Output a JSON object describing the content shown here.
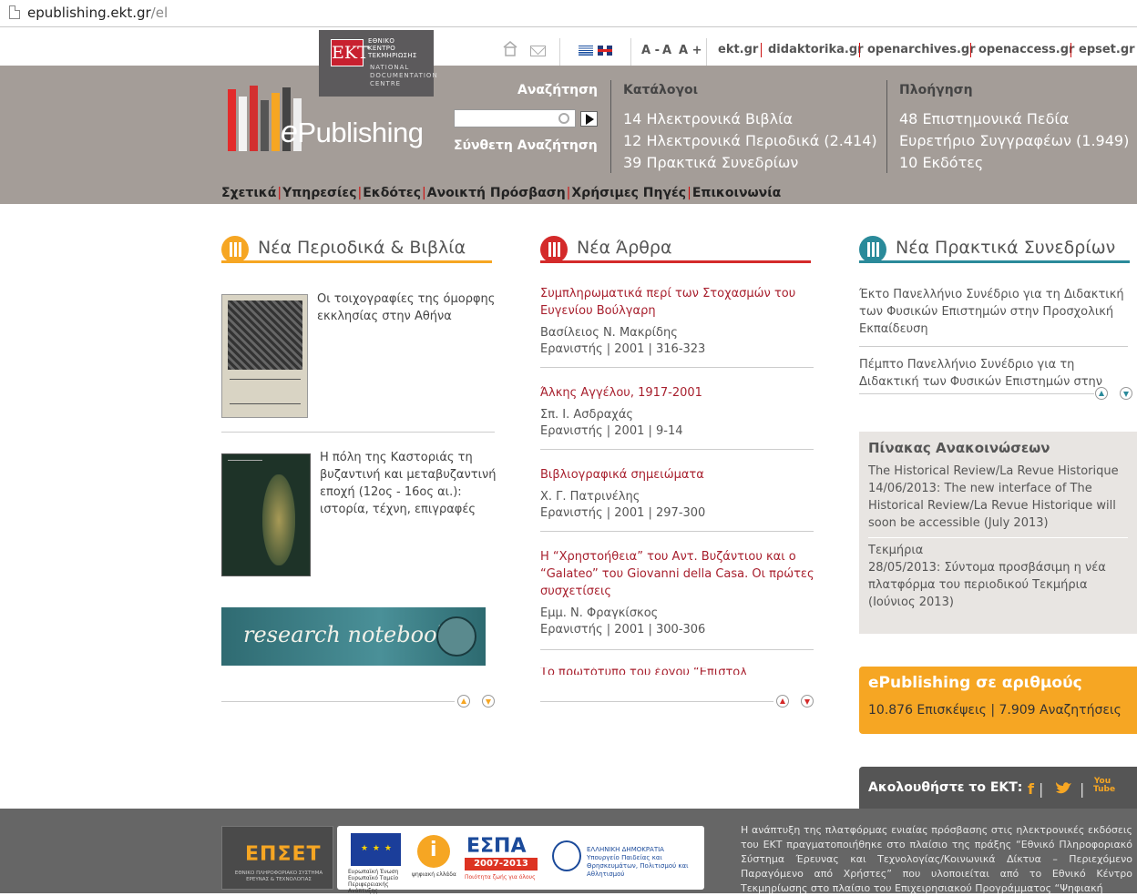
{
  "browser": {
    "url_host": "epublishing.ekt.gr",
    "url_path": "/el"
  },
  "header": {
    "ekt_logo": {
      "abbr": "ΕΚΤ",
      "greek": "ΕΘΝΙΚΟ ΚΕΝΤΡΟ ΤΕΚΜΗΡΙΩΣΗΣ",
      "english": "NATIONAL DOCUMENTATION CENTRE"
    },
    "font_sizes": [
      "A -",
      "A",
      "A +"
    ],
    "external_links": [
      "ekt.gr",
      "didaktorika.gr",
      "openarchives.gr",
      "openaccess.gr",
      "epset.gr"
    ],
    "logo_text": {
      "e": "e",
      "rest": "Publishing"
    },
    "search": {
      "label": "Αναζήτηση",
      "placeholder": "",
      "advanced": "Σύνθετη Αναζήτηση"
    },
    "catalogs": {
      "heading": "Κατάλογοι",
      "items": [
        "14 Ηλεκτρονικά Βιβλία",
        "12 Ηλεκτρονικά Περιοδικά (2.414)",
        "39 Πρακτικά Συνεδρίων"
      ]
    },
    "navigation": {
      "heading": "Πλοήγηση",
      "items": [
        "48 Επιστημονικά Πεδία",
        "Ευρετήριο Συγγραφέων (1.949)",
        "10 Εκδότες"
      ]
    },
    "main_nav": [
      "Σχετικά",
      "Υπηρεσίες",
      "Εκδότες",
      "Ανοικτή Πρόσβαση",
      "Χρήσιμες Πηγές",
      "Επικοινωνία"
    ]
  },
  "sections": {
    "books": {
      "title": "Νέα Περιοδικά & Βιβλία",
      "items": [
        {
          "title": "Οι τοιχογραφίες της όμορφης εκκλησίας στην Αθήνα"
        },
        {
          "title": "Η πόλη της Καστοριάς τη βυζαντινή και μεταβυζαντινή εποχή (12ος - 16ος αι.): ιστορία, τέχνη, επιγραφές"
        }
      ],
      "banner": "research notebooks"
    },
    "articles": {
      "title": "Νέα Άρθρα",
      "items": [
        {
          "title": "Συμπληρωματικά περί των Στοχασμών του Ευγενίου Βούλγαρη",
          "author": "Βασίλειος Ν. Μακρίδης",
          "meta": "Ερανιστής | 2001 | 316-323"
        },
        {
          "title": "Άλκης Αγγέλου, 1917-2001",
          "author": "Σπ. Ι. Ασδραχάς",
          "meta": "Ερανιστής | 2001 | 9-14"
        },
        {
          "title": "Βιβλιογραφικά σημειώματα",
          "author": "Χ. Γ. Πατρινέλης",
          "meta": "Ερανιστής | 2001 | 297-300"
        },
        {
          "title": "Η “Χρηστοήθεια” του Αντ. Βυζάντιου και ο “Galateo” του Giovanni della Casa. Οι πρώτες συσχετίσεις",
          "author": "Εμμ. Ν. Φραγκίσκος",
          "meta": "Ερανιστής | 2001 | 300-306"
        },
        {
          "title": "Το πρωτότυπο του έργου “Επιστολ"
        }
      ]
    },
    "conferences": {
      "title": "Νέα Πρακτικά Συνεδρίων",
      "items": [
        "Έκτο Πανελλήνιο Συνέδριο για τη Διδακτική των Φυσικών Επιστημών στην Προσχολική Εκπαίδευση",
        "Πέμπτο Πανελλήνιο Συνέδριο για τη Διδακτική των Φυσικών Επιστημών στην"
      ]
    }
  },
  "announcements": {
    "title": "Πίνακας Ανακοινώσεων",
    "items": [
      {
        "source": "The Historical Review/La Revue Historique",
        "text": "14/06/2013: The new interface of The Historical Review/La Revue Historique will soon be accessible (July 2013)"
      },
      {
        "source": "Τεκμήρια",
        "text": "28/05/2013: Σύντομα προσβάσιμη η νέα πλατφόρμα του περιοδικού Τεκμήρια (Ιούνιος 2013)"
      }
    ]
  },
  "stats": {
    "title": "ePublishing σε αριθμούς",
    "text": "10.876 Επισκέψεις | 7.909 Αναζητήσεις"
  },
  "follow": {
    "label": "Ακολουθήστε το ΕΚΤ:",
    "icons": [
      "facebook-icon",
      "twitter-icon",
      "youtube-icon"
    ],
    "youtube_text": "You Tube"
  },
  "footer": {
    "epset": {
      "word": "ΕΠΣΕΤ",
      "sub": "ΕΘΝΙΚΟ ΠΛΗΡΟΦΟΡΙΑΚΟ ΣΥΣΤΗΜΑ ΕΡΕΥΝΑΣ & ΤΕΧΝΟΛΟΓΙΑΣ"
    },
    "sponsors": {
      "eu_text": "Ευρωπαϊκή Ένωση Ευρωπαϊκό Ταμείο Περιφερειακής Ανάπτυξης",
      "psifiaki": "ψηφιακή ελλάδα",
      "espa": "ΕΣΠΑ",
      "espa_years": "2007-2013",
      "espa_slogan": "Ποιότητα ζωής για όλους",
      "gr_text": "ΕΛΛΗΝΙΚΗ ΔΗΜΟΚΡΑΤΙΑ Υπουργείο Παιδείας και Θρησκευμάτων, Πολιτισμού και Αθλητισμού"
    },
    "text": "Η ανάπτυξη της πλατφόρμας ενιαίας πρόσβασης στις ηλεκτρονικές εκδόσεις του ΕΚΤ πραγματοποιήθηκε στο πλαίσιο της πράξης “Εθνικό Πληροφοριακό Σύστημα Έρευνας και Τεχνολογίας/Κοινωνικά Δίκτυα – Περιεχόμενο Παραγόμενο από Χρήστες” που υλοποιείται από το Εθνικό Κέντρο Τεκμηρίωσης στο πλαίσιο του Επιχειρησιακού Προγράμματος “Ψηφιακή"
  },
  "colors": {
    "banner_gray": "#a49d98",
    "books_orange": "#f6a623",
    "articles_red": "#d42a2a",
    "conferences_teal": "#2a8a9a",
    "link_red": "#a8202e"
  }
}
